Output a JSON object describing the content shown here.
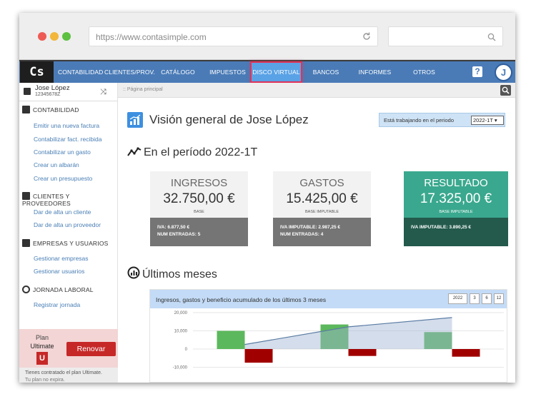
{
  "browser": {
    "url": "https://www.contasimple.com"
  },
  "nav": {
    "logo": "Cs",
    "items": [
      {
        "label": "CONTABILIDAD"
      },
      {
        "label": "CLIENTES/PROV."
      },
      {
        "label": "CATÁLOGO"
      },
      {
        "label": "IMPUESTOS"
      },
      {
        "label": "DISCO VIRTUAL"
      },
      {
        "label": "BANCOS"
      },
      {
        "label": "INFORMES"
      },
      {
        "label": "OTROS"
      }
    ],
    "help": "?",
    "avatar": "J"
  },
  "sidebar": {
    "user_name": "Jose López",
    "user_id": "12345678Z",
    "sections": [
      {
        "title": "CONTABILIDAD",
        "links": [
          "Emitir una nueva factura",
          "Contabilizar fact. recibida",
          "Contabilizar un gasto",
          "Crear un albarán",
          "Crear un presupuesto"
        ]
      },
      {
        "title": "CLIENTES Y PROVEEDORES",
        "links": [
          "Dar de alta un cliente",
          "Dar de alta un proveedor"
        ]
      },
      {
        "title": "EMPRESAS Y USUARIOS",
        "links": [
          "Gestionar empresas",
          "Gestionar usuarios"
        ]
      },
      {
        "title": "JORNADA LABORAL",
        "links": [
          "Registrar jornada"
        ]
      }
    ],
    "plan_label": "Plan",
    "plan_name": "Ultimate",
    "plan_badge": "U",
    "renew_label": "Renovar",
    "plan_note": "Tienes contratado el plan Ultimate.",
    "plan_note2": "Tu plan no expira."
  },
  "breadcrumb": ":: Página principal",
  "main": {
    "title": "Visión general de Jose López",
    "period_label": "Está trabajando en el periodo",
    "period_value": "2022-1T",
    "period_heading": "En el período 2022-1T",
    "months_heading": "Últimos meses",
    "cards": [
      {
        "label": "INGRESOS",
        "amount": "32.750,00 €",
        "sub": "BASE",
        "line1_label": "IVA:",
        "line1_value": "6.877,50 €",
        "line2_label": "NUM ENTRADAS:",
        "line2_value": "5"
      },
      {
        "label": "GASTOS",
        "amount": "15.425,00 €",
        "sub": "BASE IMPUTABLE",
        "line1_label": "IVA IMPUTABLE:",
        "line1_value": "2.987,25 €",
        "line2_label": "NUM ENTRADAS:",
        "line2_value": "4"
      },
      {
        "label": "RESULTADO",
        "amount": "17.325,00 €",
        "sub": "BASE IMPUTABLE",
        "line1_label": "IVA IMPUTABLE:",
        "line1_value": "3.890,25 €"
      }
    ],
    "chart_title": "Ingresos, gastos y beneficio acumulado de los últimos 3 meses",
    "year_buttons": [
      "2022",
      "3",
      "6",
      "12"
    ]
  },
  "colors": {
    "nav": "#4a7bb7",
    "active_nav": "#5aa2e6",
    "income": "#5cb85c",
    "expense": "#a00000",
    "result": "#3aa88e",
    "renew": "#c62828"
  },
  "chart_data": {
    "type": "bar",
    "categories": [
      "",
      "",
      ""
    ],
    "series": [
      {
        "values": [
          10000,
          13500,
          9300
        ]
      },
      {
        "values": [
          -7500,
          -3800,
          -4200
        ]
      }
    ],
    "line": {
      "values": [
        2500,
        12200,
        17300
      ]
    },
    "yticks": [
      "20,000",
      "10,000",
      "0",
      "-10,000"
    ],
    "ylim": [
      -10000,
      20000
    ]
  }
}
